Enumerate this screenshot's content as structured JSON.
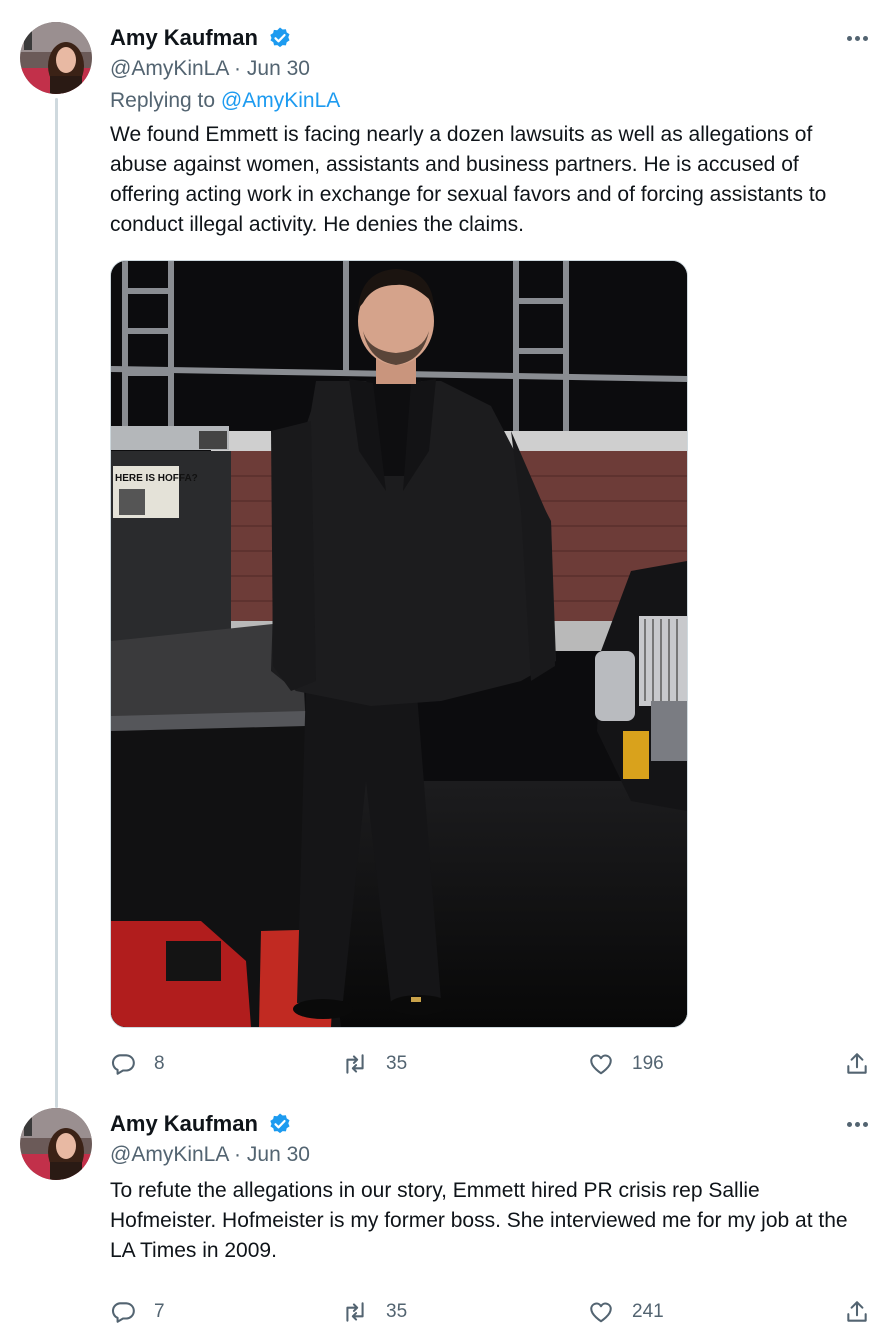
{
  "tweets": [
    {
      "author": "Amy Kaufman",
      "handle": "@AmyKinLA",
      "separator": "·",
      "date": "Jun 30",
      "replying_label": "Replying to",
      "replying_handle": "@AmyKinLA",
      "text": "We found Emmett is facing nearly a dozen lawsuits as well as allegations of abuse against women, assistants and business partners. He is accused of offering acting work in exchange for sexual favors and of forcing assistants to conduct illegal activity. He denies the claims.",
      "photo_sign_text": "HERE IS HOFFA?",
      "replies": "8",
      "retweets": "35",
      "likes": "196"
    },
    {
      "author": "Amy Kaufman",
      "handle": "@AmyKinLA",
      "separator": "·",
      "date": "Jun 30",
      "text": "To refute the allegations in our story, Emmett hired PR crisis rep Sallie Hofmeister. Hofmeister is my former boss. She interviewed me for my job at the LA Times in 2009.",
      "replies": "7",
      "retweets": "35",
      "likes": "241"
    }
  ],
  "icons": {
    "verified": "verified-badge-icon",
    "more": "more-options-icon",
    "reply": "reply-bubble-icon",
    "retweet": "retweet-icon",
    "like": "heart-icon",
    "share": "share-upload-icon"
  },
  "colors": {
    "accent": "#1d9bf0",
    "text": "#0f1419",
    "secondary": "#536471",
    "thread_line": "#cfd9de"
  }
}
